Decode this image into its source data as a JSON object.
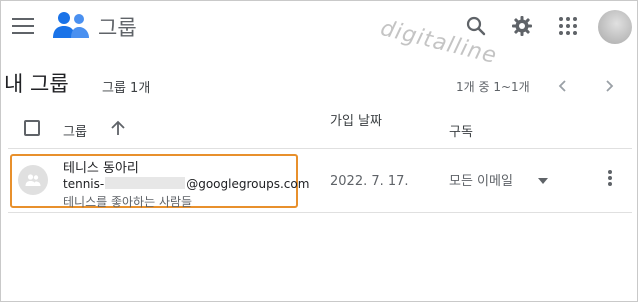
{
  "header": {
    "app_title": "그룹",
    "watermark": "digitalline",
    "icons": [
      "menu-icon",
      "groups-logo-icon",
      "search-icon",
      "gear-icon",
      "apps-grid-icon",
      "avatar"
    ]
  },
  "page": {
    "title": "내 그룹",
    "group_count": "그룹 1개",
    "pagination": "1개 중 1~1개"
  },
  "table": {
    "columns": {
      "group": "그룹",
      "joined": "가입 날짜",
      "subscription": "구독"
    },
    "rows": [
      {
        "name": "테니스 동아리",
        "email_prefix": "tennis-",
        "email_suffix": "@googlegroups.com",
        "description": "테니스를 좋아하는 사람들",
        "joined": "2022. 7. 17.",
        "subscription": "모든 이메일"
      }
    ]
  },
  "colors": {
    "highlight_border": "#e8902c",
    "brand_blue": "#1a73e8",
    "icon_gray": "#5f6368"
  }
}
